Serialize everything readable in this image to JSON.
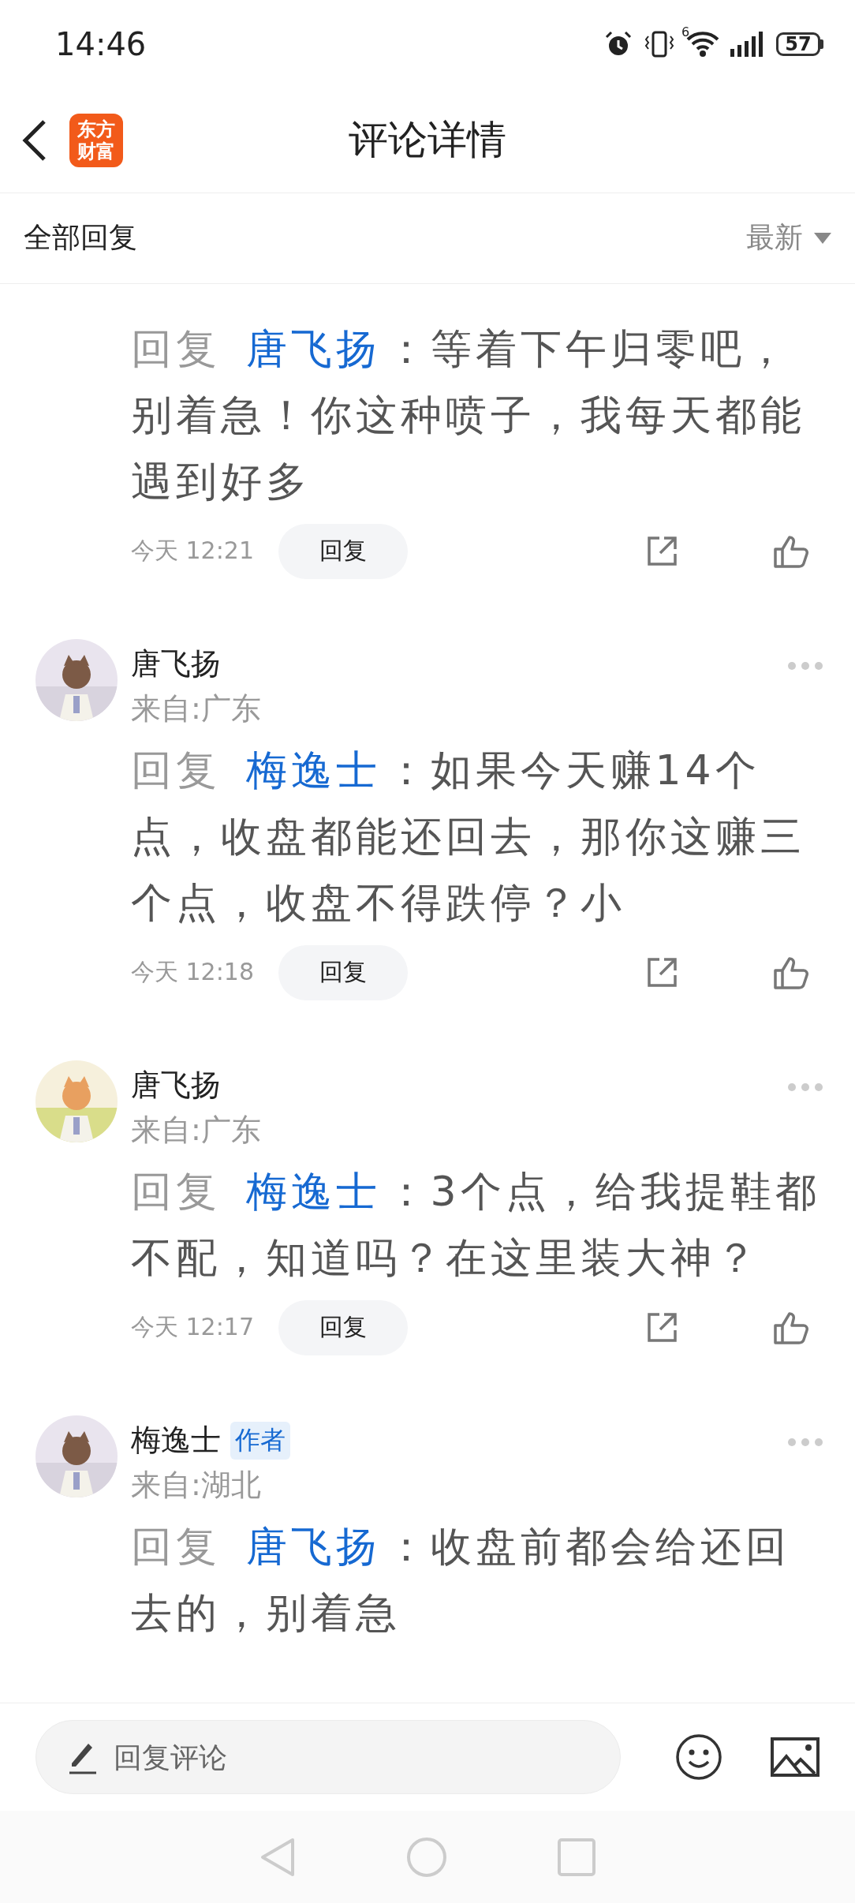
{
  "status_bar": {
    "time": "14:46",
    "wifi_badge": "6",
    "battery": "57"
  },
  "header": {
    "logo_lines": [
      "东方",
      "财富"
    ],
    "title": "评论详情"
  },
  "filter": {
    "label": "全部回复",
    "sort": "最新"
  },
  "comments": [
    {
      "text": "*回复* **唐飞扬**：等着下午归零吧，别着急！你这种喷子，我每天都能遇到好多",
      "time": "今天 12:21",
      "reply_button": "回复"
    },
    {
      "author": "唐飞扬",
      "location": "来自:广东",
      "text": "*回复* **梅逸士**：如果今天赚14个点，收盘都能还回去，那你这赚三个点，收盘不得跌停？小",
      "time": "今天 12:18",
      "reply_button": "回复"
    },
    {
      "author": "唐飞扬",
      "location": "来自:广东",
      "text": "*回复* **梅逸士**：3个点，给我提鞋都不配，知道吗？在这里装大神？",
      "time": "今天 12:17",
      "reply_button": "回复"
    },
    {
      "author": "梅逸士",
      "badge": "作者",
      "location": "来自:湖北",
      "text": "*回复* **唐飞扬**：收盘前都会给还回去的，别着急"
    }
  ],
  "composer": {
    "placeholder": "回复评论"
  }
}
